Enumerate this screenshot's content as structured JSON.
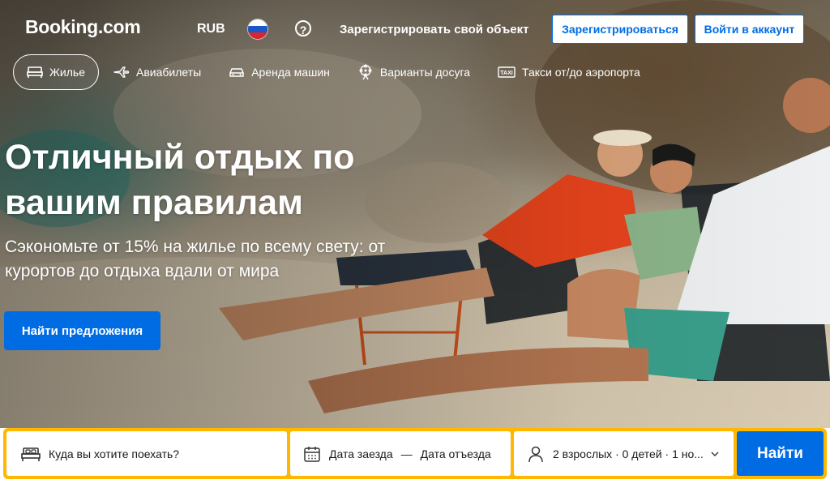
{
  "header": {
    "logo": "Booking.com",
    "currency": "RUB",
    "list_property": "Зарегистрировать свой объект",
    "register": "Зарегистрироваться",
    "login": "Войти в аккаунт",
    "help_symbol": "?"
  },
  "nav": {
    "items": [
      {
        "label": "Жилье",
        "icon": "bed-icon",
        "active": true
      },
      {
        "label": "Авиабилеты",
        "icon": "plane-icon"
      },
      {
        "label": "Аренда машин",
        "icon": "car-icon"
      },
      {
        "label": "Варианты досуга",
        "icon": "attractions-icon"
      },
      {
        "label": "Такси от/до аэропорта",
        "icon": "taxi-icon"
      }
    ]
  },
  "hero": {
    "title": "Отличный отдых по вашим правилам",
    "subtitle": "Сэкономьте от 15% на жилье по всему свету: от курортов до отдыха вдали от мира",
    "cta": "Найти предложения"
  },
  "search": {
    "destination_placeholder": "Куда вы хотите поехать?",
    "checkin": "Дата заезда",
    "dash": "—",
    "checkout": "Дата отъезда",
    "guests": "2 взрослых · 0 детей · 1 но...",
    "submit": "Найти"
  },
  "colors": {
    "brand_blue": "#006ce4",
    "search_yellow": "#ffb700"
  }
}
